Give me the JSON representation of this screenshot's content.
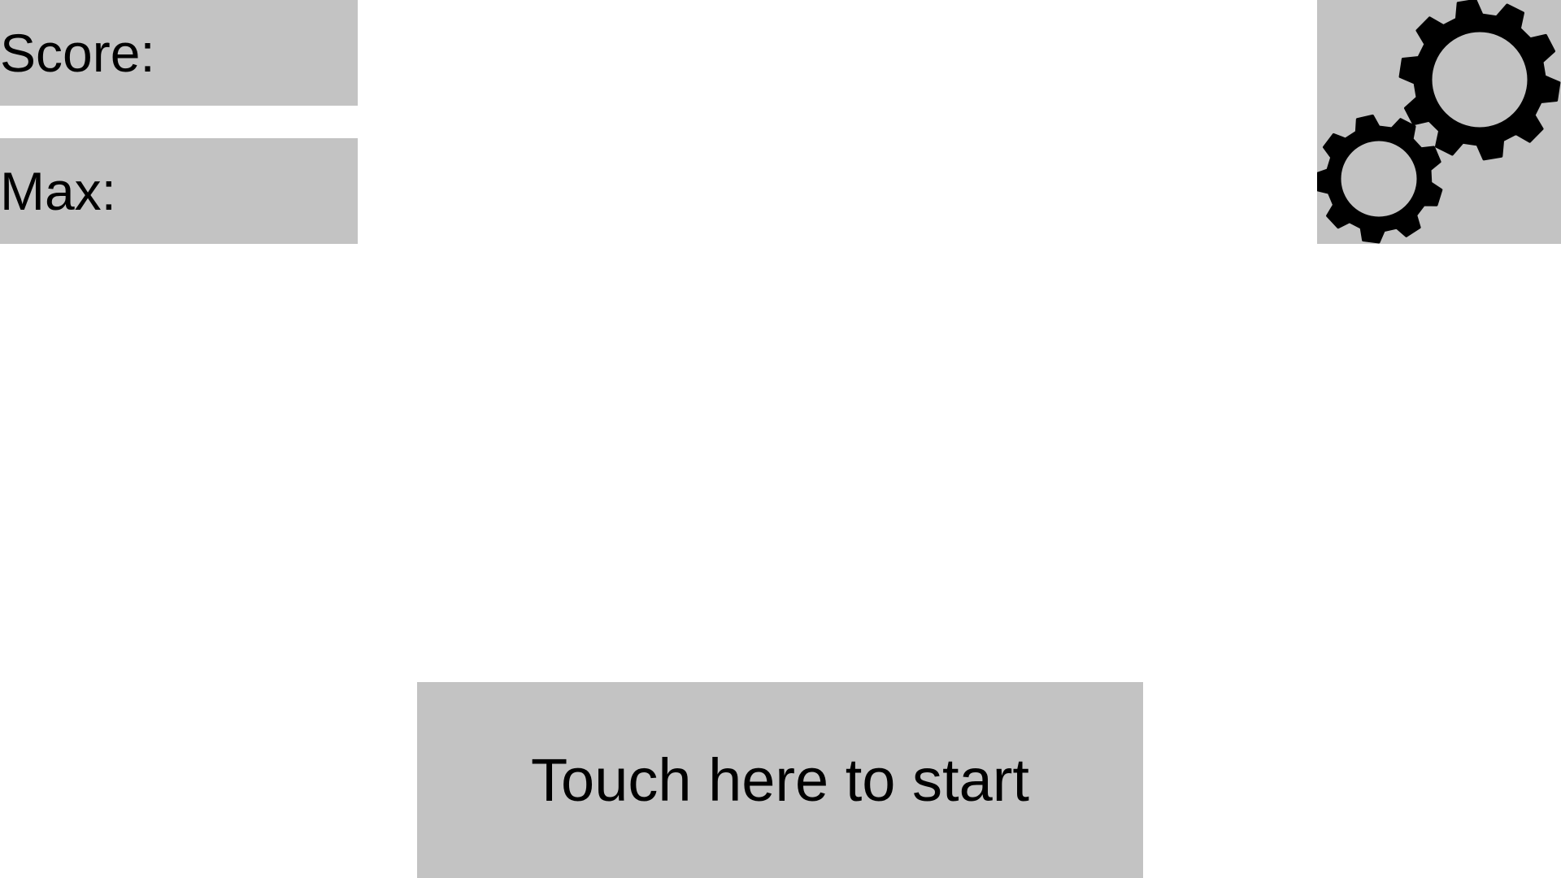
{
  "hud": {
    "score_label": "Score:",
    "score_value": "",
    "max_label": "Max:",
    "max_value": ""
  },
  "settings": {
    "icon": "gears-icon"
  },
  "start": {
    "label": "Touch here to start"
  },
  "colors": {
    "panel": "#c3c3c3",
    "background": "#ffffff",
    "text": "#000000"
  }
}
